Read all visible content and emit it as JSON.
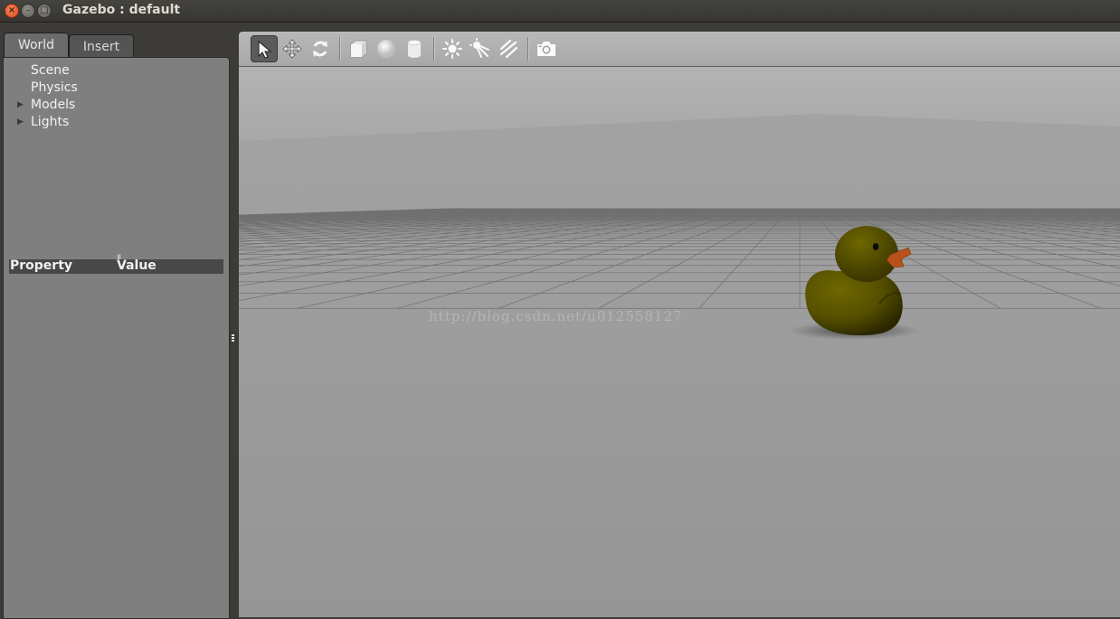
{
  "window": {
    "title": "Gazebo : default",
    "controls": {
      "close": "×",
      "minimize": "–",
      "maximize": "□"
    }
  },
  "left_panel": {
    "tabs": [
      {
        "label": "World",
        "active": true
      },
      {
        "label": "Insert",
        "active": false
      }
    ],
    "tree": [
      {
        "label": "Scene",
        "expandable": false
      },
      {
        "label": "Physics",
        "expandable": false
      },
      {
        "label": "Models",
        "expandable": true
      },
      {
        "label": "Lights",
        "expandable": true
      }
    ],
    "property_table": {
      "columns": [
        "Property",
        "Value"
      ]
    }
  },
  "toolbar": {
    "tools": [
      {
        "name": "select-tool",
        "icon": "arrow-cursor-icon",
        "active": true
      },
      {
        "name": "translate-tool",
        "icon": "move-arrows-icon",
        "active": false
      },
      {
        "name": "rotate-tool",
        "icon": "rotate-icon",
        "active": false
      },
      {
        "name": "box-tool",
        "icon": "box-icon",
        "active": false
      },
      {
        "name": "sphere-tool",
        "icon": "sphere-icon",
        "active": false
      },
      {
        "name": "cylinder-tool",
        "icon": "cylinder-icon",
        "active": false
      },
      {
        "name": "point-light-tool",
        "icon": "sun-icon",
        "active": false
      },
      {
        "name": "spot-light-tool",
        "icon": "spot-light-icon",
        "active": false
      },
      {
        "name": "directional-light-tool",
        "icon": "directional-light-icon",
        "active": false
      },
      {
        "name": "screenshot-tool",
        "icon": "camera-icon",
        "active": false
      }
    ]
  },
  "viewport": {
    "scene_object": "rubber-duck-model",
    "watermark": "http://blog.csdn.net/u012558127"
  },
  "colors": {
    "ground": "#9a9a9a",
    "sky": "#b0b0b0",
    "grid_line": "#6a6a6a",
    "duck_body": "#5c5500",
    "duck_beak": "#b8521a",
    "panel_bg": "#7f7f7f",
    "toolbar_bg": "#b0b0b0",
    "close_button": "#e05a2b"
  }
}
